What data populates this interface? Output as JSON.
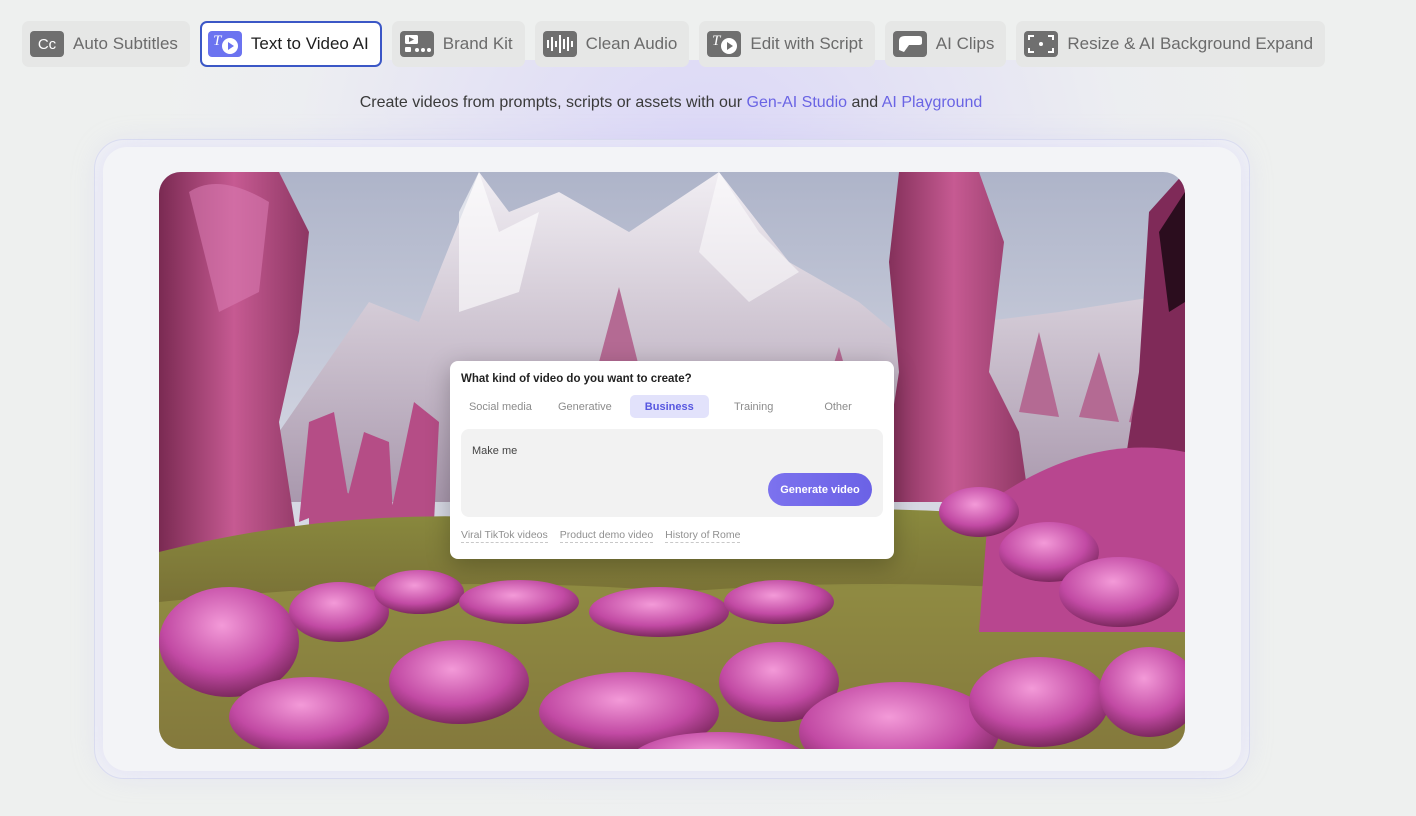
{
  "tabs": [
    {
      "label": "Auto Subtitles",
      "icon": "cc-icon",
      "active": false
    },
    {
      "label": "Text to Video AI",
      "icon": "text-to-video-icon",
      "active": true
    },
    {
      "label": "Brand Kit",
      "icon": "brand-kit-icon",
      "active": false
    },
    {
      "label": "Clean Audio",
      "icon": "audio-waveform-icon",
      "active": false
    },
    {
      "label": "Edit with Script",
      "icon": "script-edit-icon",
      "active": false
    },
    {
      "label": "AI Clips",
      "icon": "clips-icon",
      "active": false
    },
    {
      "label": "Resize & AI Background Expand",
      "icon": "resize-expand-icon",
      "active": false
    }
  ],
  "subline": {
    "text_before": "Create videos from prompts, scripts or assets with our",
    "link1": "Gen-AI Studio",
    "text_mid": "and",
    "link2": "AI Playground"
  },
  "prompt_card": {
    "question": "What kind of video do you want to create?",
    "categories": [
      "Social media",
      "Generative",
      "Business",
      "Training",
      "Other"
    ],
    "selected_category": "Business",
    "input_value": "Make me",
    "generate_label": "Generate video",
    "suggestions": [
      "Viral TikTok videos",
      "Product demo video",
      "History of Rome"
    ]
  },
  "colors": {
    "accent": "#6b62e6",
    "active_tab_border": "#3b57c6",
    "link": "#6a64e4",
    "scene_magenta": "#c9479e"
  }
}
